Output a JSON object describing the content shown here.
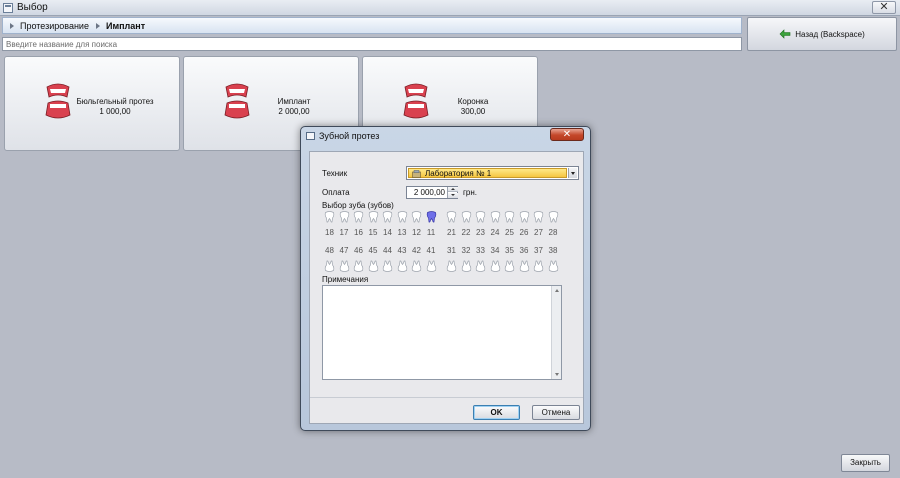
{
  "window": {
    "title": "Выбор",
    "close_glyph": "✕"
  },
  "breadcrumb": {
    "items": [
      "Протезирование",
      "Имплант"
    ]
  },
  "search": {
    "placeholder": "Введите название для поиска",
    "value": ""
  },
  "back_button": {
    "label": "Назад (Backspace)",
    "icon": "back-arrow-icon",
    "icon_color": "#3ca33c"
  },
  "tiles": [
    {
      "name": "Бюльгельный протез",
      "price": "1 000,00",
      "icon": "dentures-icon"
    },
    {
      "name": "Имплант",
      "price": "2 000,00",
      "icon": "dentures-icon"
    },
    {
      "name": "Коронка",
      "price": "300,00",
      "icon": "dentures-icon"
    }
  ],
  "main_close_button": {
    "label": "Закрыть"
  },
  "dialog": {
    "title": "Зубной протез",
    "close_glyph": "✕",
    "technician_label": "Техник",
    "technician_value": "Лаборатория № 1",
    "payment_label": "Оплата",
    "payment_value": "2 000,00",
    "payment_unit": "грн.",
    "teeth_label": "Выбор зуба (зубов)",
    "upper_teeth": [
      "18",
      "17",
      "16",
      "15",
      "14",
      "13",
      "12",
      "11",
      "21",
      "22",
      "23",
      "24",
      "25",
      "26",
      "27",
      "28"
    ],
    "lower_teeth": [
      "48",
      "47",
      "46",
      "45",
      "44",
      "43",
      "42",
      "41",
      "31",
      "32",
      "33",
      "34",
      "35",
      "36",
      "37",
      "38"
    ],
    "selected_tooth": "11",
    "notes_label": "Примечания",
    "notes_value": "",
    "ok_label": "OK",
    "cancel_label": "Отмена"
  },
  "colors": {
    "selected_tooth": "#6f6fe8",
    "highlight": "#f5c641"
  }
}
